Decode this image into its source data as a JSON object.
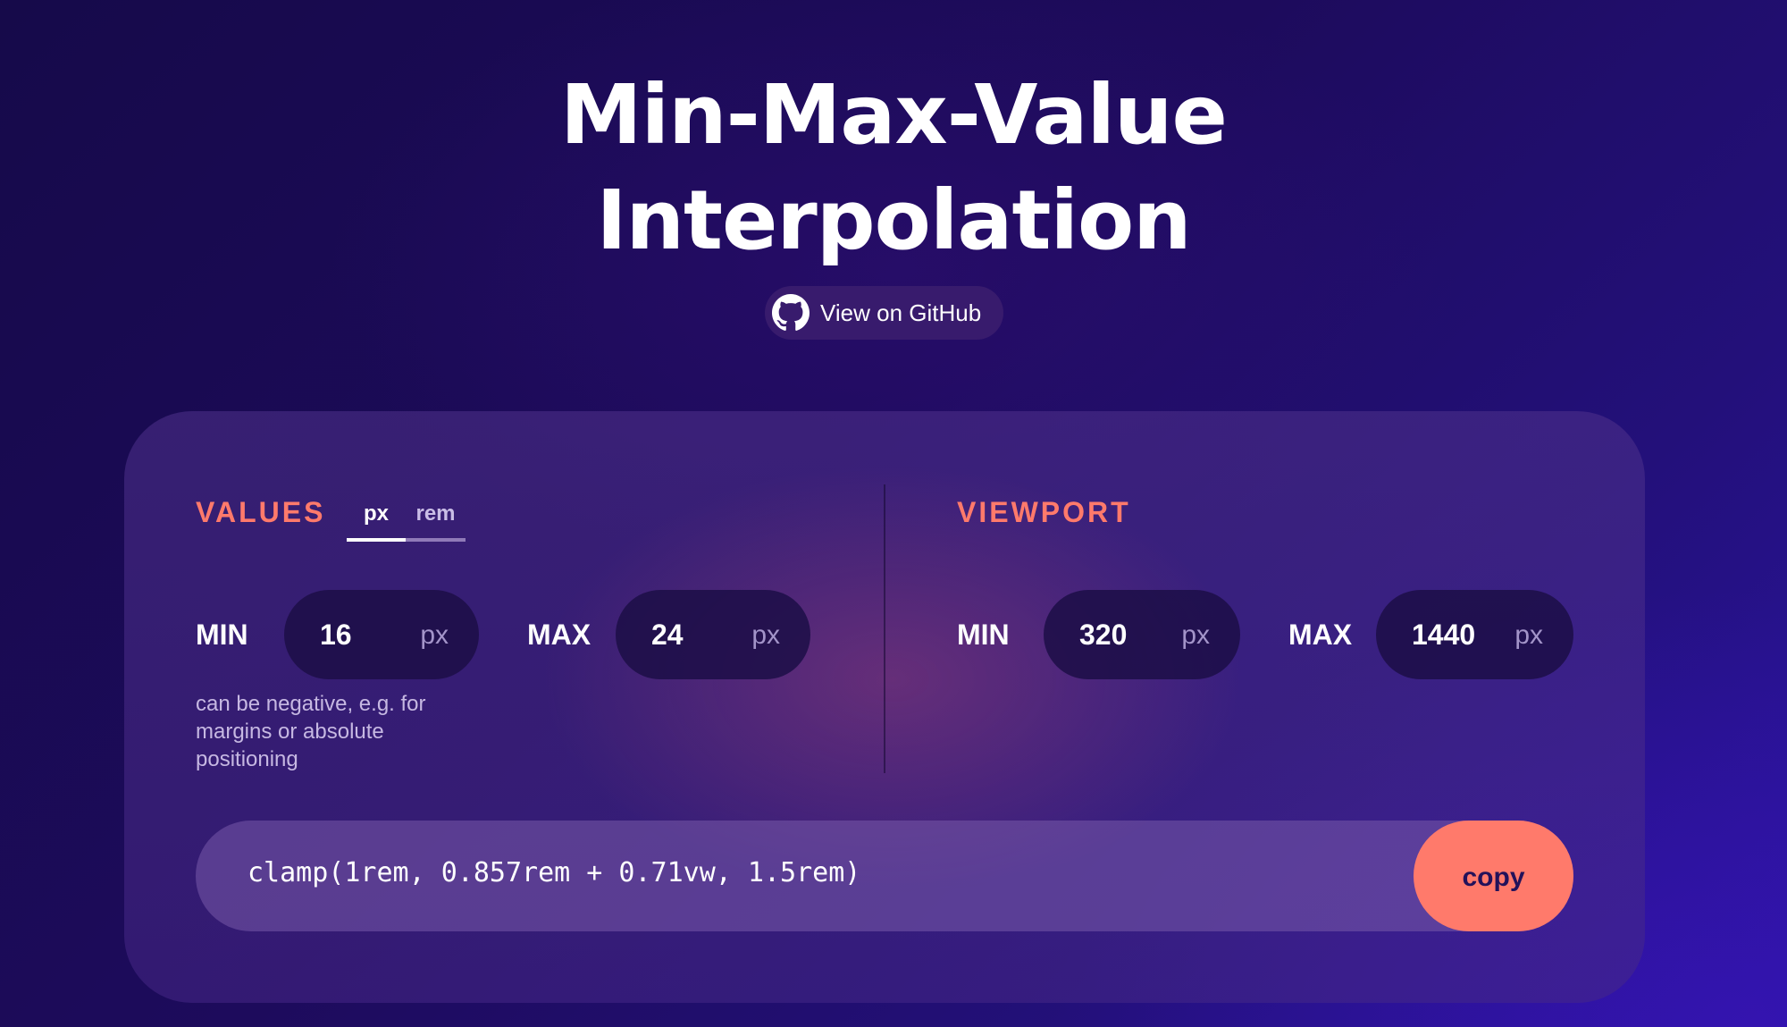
{
  "header": {
    "title_line1": "Min-Max-Value",
    "title_line2": "Interpolation",
    "github_label": "View on GitHub",
    "github_icon": "github-icon"
  },
  "values": {
    "label": "VALUES",
    "unit_tabs": {
      "px": "px",
      "rem": "rem",
      "selected": "px"
    },
    "min_label": "MIN",
    "min_value": "16",
    "min_unit": "px",
    "max_label": "MAX",
    "max_value": "24",
    "max_unit": "px",
    "hint": "can be negative, e.g. for margins or absolute positioning"
  },
  "viewport": {
    "label": "VIEWPORT",
    "min_label": "MIN",
    "min_value": "320",
    "min_unit": "px",
    "max_label": "MAX",
    "max_value": "1440",
    "max_unit": "px"
  },
  "output": {
    "text": "clamp(1rem, 0.857rem + 0.71vw, 1.5rem)",
    "copy_label": "copy"
  },
  "colors": {
    "accent": "#ff7a6b",
    "background": "#1d0b5c",
    "pill": "#1c0e46"
  }
}
